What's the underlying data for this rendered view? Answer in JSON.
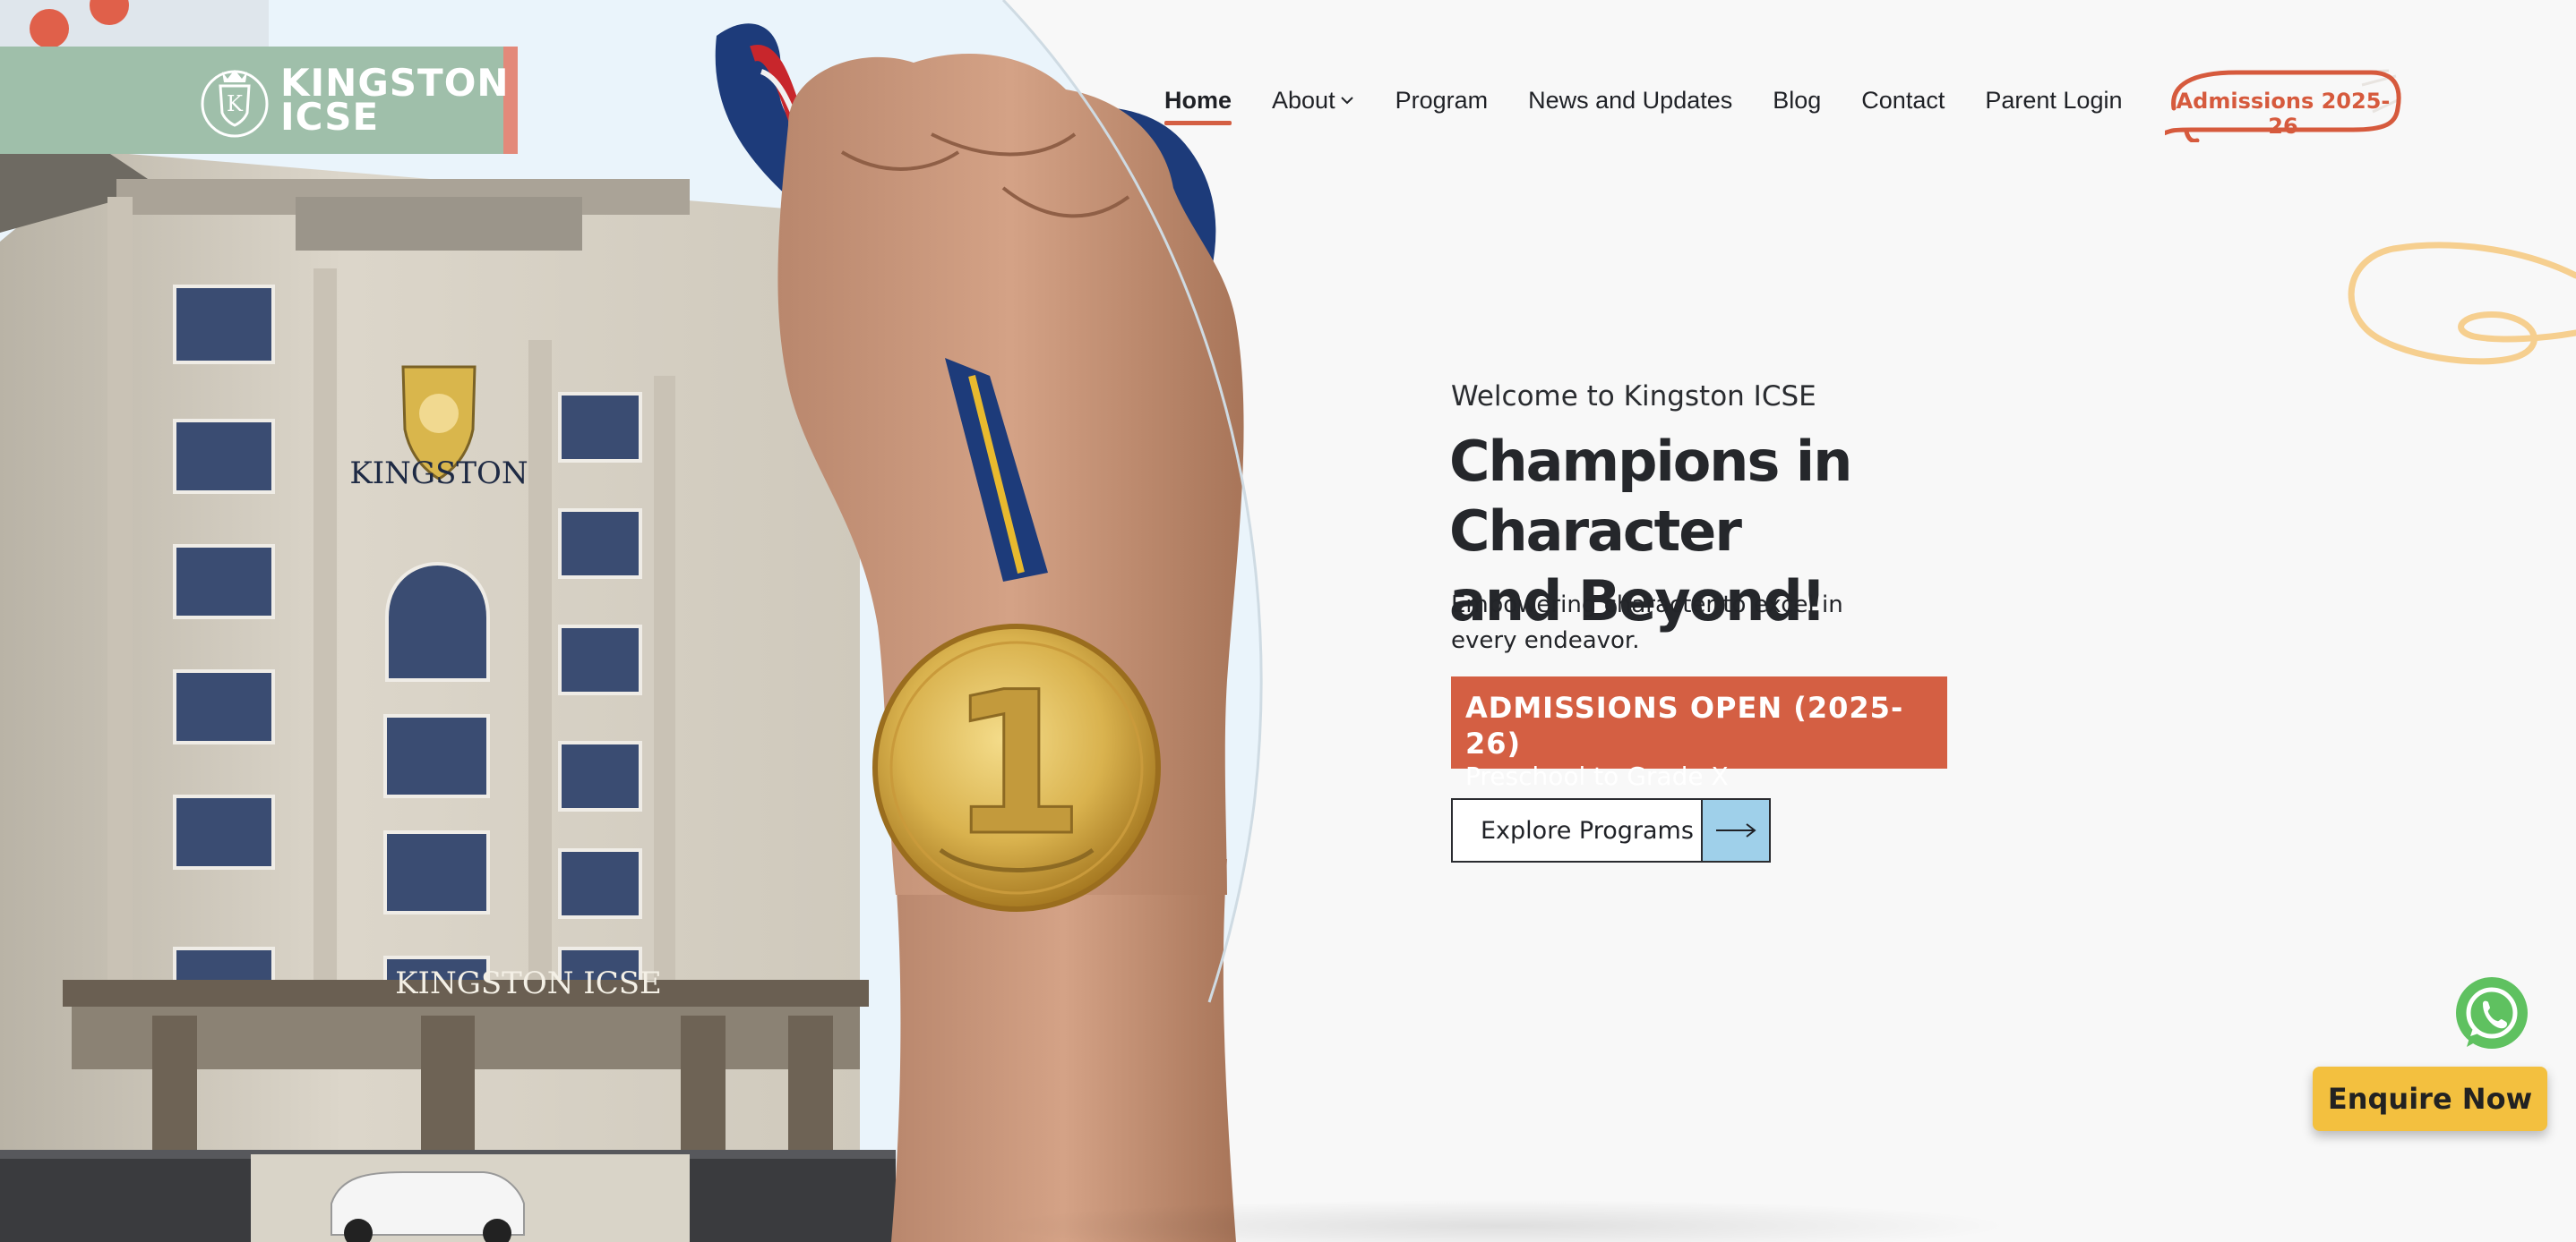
{
  "logo": {
    "line1": "KINGSTON",
    "line2": "ICSE",
    "alt": "Kingston ICSE"
  },
  "nav": {
    "items": [
      {
        "label": "Home",
        "active": true
      },
      {
        "label": "About",
        "has_dropdown": true
      },
      {
        "label": "Program"
      },
      {
        "label": "News and Updates"
      },
      {
        "label": "Blog"
      },
      {
        "label": "Contact"
      },
      {
        "label": "Parent Login"
      }
    ],
    "cta_label": "Admissions 2025-26"
  },
  "hero": {
    "welcome": "Welcome to Kingston ICSE",
    "headline_line1": "Champions in Character",
    "headline_line2": "and Beyond!",
    "subtext_line1": "Empowering character to excel in",
    "subtext_line2": "every endeavor.",
    "admission_title": "ADMISSIONS OPEN (2025-26)",
    "admission_subtitle": "Preschool to Grade X",
    "explore_label": "Explore Programs",
    "building_sign": "KINGSTON ICSE",
    "building_crest_text": "KINGSTON",
    "medal_number": "1"
  },
  "widgets": {
    "enquire_label": "Enquire Now"
  },
  "colors": {
    "accent": "#d45f43",
    "logo_bg": "#9fbfaa",
    "enquire_bg": "#f3c03f",
    "explore_arrow_bg": "#9fd0ea",
    "whatsapp": "#5fc160"
  }
}
